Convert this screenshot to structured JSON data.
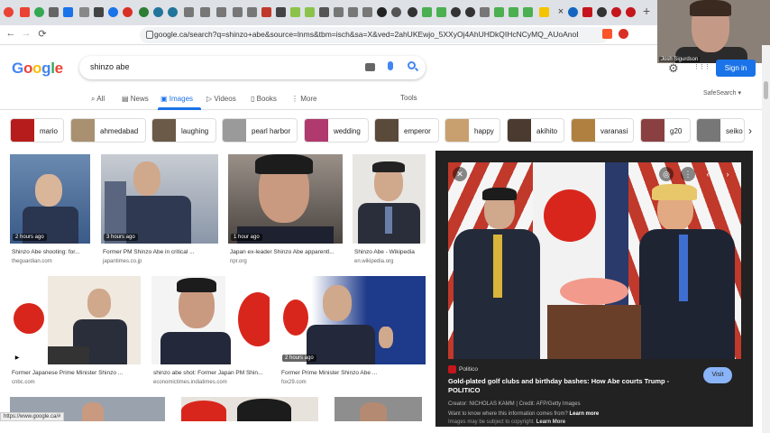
{
  "browser": {
    "url": "google.ca/search?q=shinzo+abe&source=lnms&tbm=isch&sa=X&ved=2ahUKEwjo_5XXyOj4AhUHDkQIHcNCyMQ_AUoAnoECAQBAI&biw...",
    "tab_close": "×",
    "new_tab": "+",
    "back": "←",
    "forward": "→",
    "reload": "⟳",
    "status_url": "https://www.google.ca/#"
  },
  "webcam": {
    "name": "Josh Sigurdson"
  },
  "header": {
    "logo_letters": [
      "G",
      "o",
      "o",
      "g",
      "l",
      "e"
    ],
    "logo_colors": [
      "#4285f4",
      "#ea4335",
      "#fbbc05",
      "#4285f4",
      "#34a853",
      "#ea4335"
    ],
    "query": "shinzo abe",
    "sign_in": "Sign in",
    "safesearch": "SafeSearch ▾",
    "gear": "⚙",
    "apps": "⋮⋮⋮"
  },
  "nav": {
    "all": "All",
    "news": "News",
    "images": "Images",
    "videos": "Videos",
    "books": "Books",
    "more": "More",
    "tools": "Tools"
  },
  "chips": [
    "mario",
    "ahmedabad",
    "laughing",
    "pearl harbor",
    "wedding",
    "emperor",
    "happy",
    "akihito",
    "varanasi",
    "g20",
    "seiko"
  ],
  "chip_next": "›",
  "results": [
    {
      "tag": "2 hours ago",
      "caption": "Shinzo Abe shooting: for...",
      "source": "theguardian.com"
    },
    {
      "tag": "3 hours ago",
      "caption": "Former PM Shinzo Abe in critical ...",
      "source": "japantimes.co.jp"
    },
    {
      "tag": "1 hour ago",
      "caption": "Japan ex-leader Shinzo Abe apparentl...",
      "source": "npr.org"
    },
    {
      "tag": "",
      "caption": "Shinzo Abe - Wikipedia",
      "source": "en.wikipedia.org"
    },
    {
      "tag": "",
      "caption": "Former Japanese Prime Minister Shinzo ...",
      "source": "cnbc.com"
    },
    {
      "tag": "",
      "caption": "shinzo abe shot: Former Japan PM Shin...",
      "source": "economictimes.indiatimes.com"
    },
    {
      "tag": "2 hours ago",
      "caption": "Former Prime Minister Shinzo Abe ...",
      "source": "fox29.com"
    }
  ],
  "panel": {
    "close": "✕",
    "prev": "‹",
    "next": "›",
    "more": "⋮",
    "source": "Politico",
    "title": "Gold-plated golf clubs and birthday bashes: How Abe courts Trump - POLITICO",
    "visit": "Visit",
    "credit": "Creator: NICHOLAS KAMM | Credit: AFP/Getty Images",
    "know": "Want to know where this information comes from?",
    "learn": "Learn more",
    "note": "Images may be subject to copyright.",
    "note_learn": "Learn More"
  },
  "colors": {
    "accent": "#1a73e8",
    "panel": "#222222"
  }
}
